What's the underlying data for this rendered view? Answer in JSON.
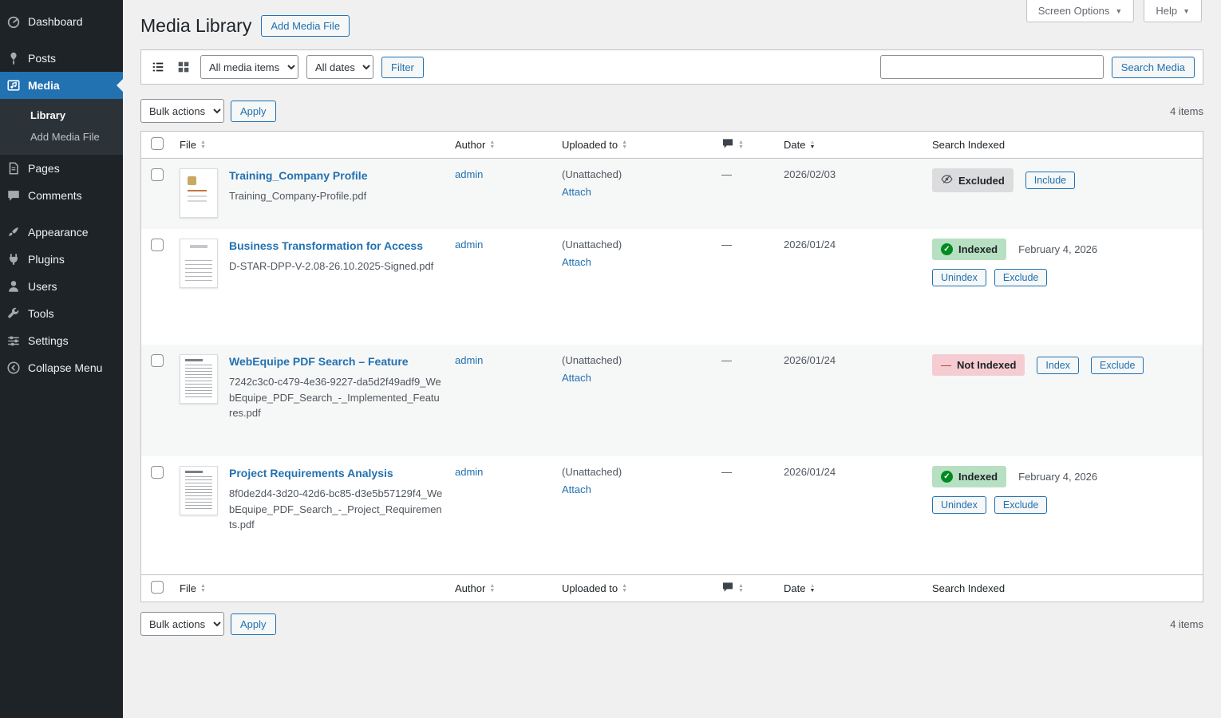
{
  "colors": {
    "accent": "#2271b1",
    "page_bg": "#f0f0f1",
    "sidebar_bg": "#1d2327",
    "badge_excluded_bg": "#dcdcde",
    "badge_indexed_bg": "#b7e0c3",
    "badge_not_indexed_bg": "#f5ccd1",
    "success_green": "#008a20",
    "danger_red": "#b32d2e"
  },
  "screen_tabs": {
    "screen_options": "Screen Options",
    "help": "Help",
    "caret_icon": "chevron-down-icon"
  },
  "page": {
    "title": "Media Library",
    "add_media_label": "Add Media File"
  },
  "sidebar": {
    "items": [
      {
        "label": "Dashboard",
        "icon": "dashboard-icon"
      },
      {
        "label": "Posts",
        "icon": "pushpin-icon"
      },
      {
        "label": "Media",
        "icon": "media-icon",
        "active": true
      },
      {
        "label": "Pages",
        "icon": "pages-icon"
      },
      {
        "label": "Comments",
        "icon": "comments-icon"
      },
      {
        "label": "Appearance",
        "icon": "appearance-icon"
      },
      {
        "label": "Plugins",
        "icon": "plugins-icon"
      },
      {
        "label": "Users",
        "icon": "users-icon"
      },
      {
        "label": "Tools",
        "icon": "tools-icon"
      },
      {
        "label": "Settings",
        "icon": "settings-icon"
      },
      {
        "label": "Collapse Menu",
        "icon": "collapse-icon"
      }
    ],
    "media_submenu": [
      {
        "label": "Library",
        "active": true
      },
      {
        "label": "Add Media File"
      }
    ]
  },
  "filters": {
    "list_view_icon": "list-view-icon",
    "grid_view_icon": "grid-view-icon",
    "media_type": "All media items",
    "dates": "All dates",
    "filter_button": "Filter",
    "search_value": "",
    "search_button": "Search Media"
  },
  "bulk": {
    "label": "Bulk actions",
    "apply": "Apply",
    "count": "4 items"
  },
  "table": {
    "headers": {
      "file": "File",
      "author": "Author",
      "uploaded_to": "Uploaded to",
      "comments_icon": "comment-bubble-icon",
      "date": "Date",
      "search_indexed": "Search Indexed"
    },
    "rows": [
      {
        "title": "Training_Company Profile",
        "filename": "Training_Company-Profile.pdf",
        "author": "admin",
        "uploaded": "(Unattached)",
        "attach": "Attach",
        "comments": "—",
        "date": "2026/02/03",
        "status": "Excluded",
        "status_icon": "eye-slash-icon",
        "actions": [
          "Include"
        ]
      },
      {
        "title": "Business Transformation for Access",
        "filename": "D-STAR-DPP-V-2.08-26.10.2025-Signed.pdf",
        "author": "admin",
        "uploaded": "(Unattached)",
        "attach": "Attach",
        "comments": "—",
        "date": "2026/01/24",
        "status": "Indexed",
        "status_icon": "check-circle-icon",
        "indexed_date": "February 4, 2026",
        "actions": [
          "Unindex",
          "Exclude"
        ]
      },
      {
        "title": "WebEquipe PDF Search – Feature",
        "filename": "7242c3c0-c479-4e36-9227-da5d2f49adf9_WebEquipe_PDF_Search_-_Implemented_Features.pdf",
        "author": "admin",
        "uploaded": "(Unattached)",
        "attach": "Attach",
        "comments": "—",
        "date": "2026/01/24",
        "status": "Not Indexed",
        "status_icon": "dash-icon",
        "actions": [
          "Index",
          "Exclude"
        ]
      },
      {
        "title": "Project Requirements Analysis",
        "filename": "8f0de2d4-3d20-42d6-bc85-d3e5b57129f4_WebEquipe_PDF_Search_-_Project_Requirements.pdf",
        "author": "admin",
        "uploaded": "(Unattached)",
        "attach": "Attach",
        "comments": "—",
        "date": "2026/01/24",
        "status": "Indexed",
        "status_icon": "check-circle-icon",
        "indexed_date": "February 4, 2026",
        "actions": [
          "Unindex",
          "Exclude"
        ]
      }
    ]
  }
}
